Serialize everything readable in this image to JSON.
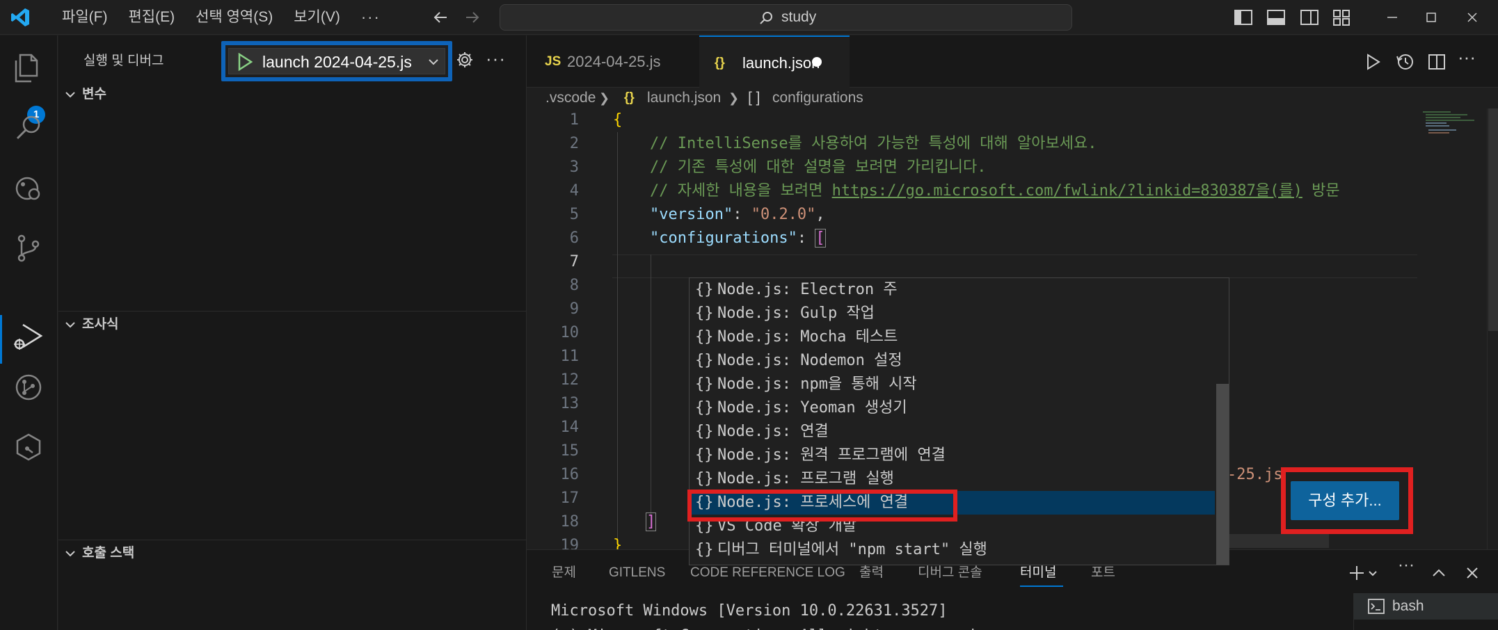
{
  "titlebar": {
    "menu": [
      "파일(F)",
      "편집(E)",
      "선택 영역(S)",
      "보기(V)"
    ],
    "more": "···",
    "search_text": "study",
    "colors": {
      "accent": "#0078d4",
      "logo": "#23a9f2"
    }
  },
  "activitybar": {
    "items": [
      "explorer-icon",
      "search-icon",
      "remote-explorer-icon",
      "source-control-icon",
      "run-debug-icon",
      "gitlens-icon",
      "extensions-icon"
    ],
    "explorer_badge": "1"
  },
  "sidebar": {
    "title": "실행 및 디버그",
    "launch_config": "launch 2024-04-25.js",
    "more": "···",
    "sections": [
      {
        "label": "변수"
      },
      {
        "label": "조사식"
      },
      {
        "label": "호출 스택"
      }
    ]
  },
  "editor": {
    "tabs": [
      {
        "icon": "JS",
        "label": "2024-04-25.js"
      },
      {
        "icon": "{}",
        "label": "launch.json"
      }
    ],
    "breadcrumbs": [
      ".vscode",
      "{}",
      "launch.json",
      "[ ]",
      "configurations"
    ],
    "lines": [
      {
        "n": "1"
      },
      {
        "n": "2"
      },
      {
        "n": "3"
      },
      {
        "n": "4"
      },
      {
        "n": "5"
      },
      {
        "n": "6"
      },
      {
        "n": "7"
      },
      {
        "n": "8"
      },
      {
        "n": "9"
      },
      {
        "n": "10"
      },
      {
        "n": "11"
      },
      {
        "n": "12"
      },
      {
        "n": "13"
      },
      {
        "n": "14"
      },
      {
        "n": "15"
      },
      {
        "n": "16"
      },
      {
        "n": "17"
      },
      {
        "n": "18"
      },
      {
        "n": "19"
      }
    ],
    "code": {
      "l1": "{",
      "l2": "    // IntelliSense를 사용하여 가능한 특성에 대해 알아보세요.",
      "l3": "    // 기존 특성에 대한 설명을 보려면 가리킵니다.",
      "l4_pre": "    // 자세한 내용을 보려면 ",
      "l4_link": "https://go.microsoft.com/fwlink/?linkid=830387을(를)",
      "l4_post": " 방문",
      "l5_key": "\"version\"",
      "l5_colon": ": ",
      "l5_val": "\"0.2.0\"",
      "l5_comma": ",",
      "l6_key": "\"configurations\"",
      "l6_colon": ": ",
      "l6_br": "[",
      "l16_tail": "-25.js\"",
      "l18": "]",
      "l19": "}"
    },
    "suggestions": [
      "Node.js: Electron 주",
      "Node.js: Gulp 작업",
      "Node.js: Mocha 테스트",
      "Node.js: Nodemon 설정",
      "Node.js: npm을 통해 시작",
      "Node.js: Yeoman 생성기",
      "Node.js: 연결",
      "Node.js: 원격 프로그램에 연결",
      "Node.js: 프로그램 실행",
      "Node.js: 프로세스에 연결",
      "VS Code 확장 개발",
      "디버그 터미널에서 \"npm start\" 실행"
    ],
    "suggestion_icon": "{}",
    "add_config_label": "구성 추가..."
  },
  "panel": {
    "tabs": [
      "문제",
      "GITLENS",
      "CODE REFERENCE LOG",
      "출력",
      "디버그 콘솔",
      "터미널",
      "포트"
    ],
    "active_tab": "터미널",
    "terminal_line1": "Microsoft Windows [Version 10.0.22631.3527]",
    "terminal_line2": "(c) Microsoft Corporation. All rights reserved.",
    "terminal_name": "bash"
  }
}
